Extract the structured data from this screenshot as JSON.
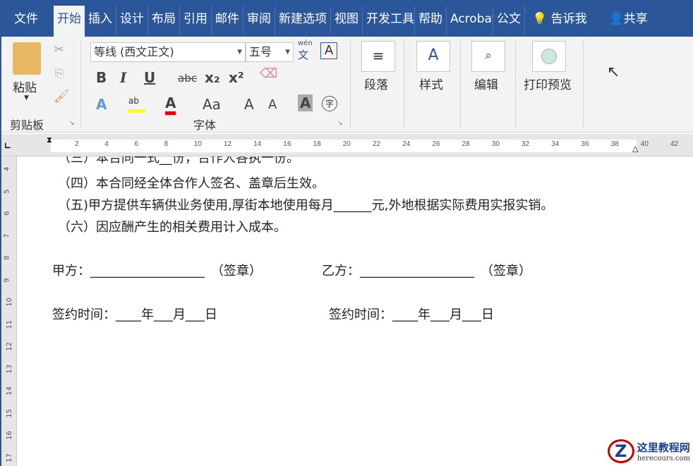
{
  "tabs": [
    "文件",
    "开始",
    "插入",
    "设计",
    "布局",
    "引用",
    "邮件",
    "审阅",
    "新建选项",
    "视图",
    "开发工具",
    "帮助",
    "Acrobat",
    "公文"
  ],
  "tell_me": "告诉我",
  "share": "共享",
  "clipboard": {
    "paste": "粘贴",
    "group": "剪贴板"
  },
  "font": {
    "name": "等线 (西文正文)",
    "size": "五号",
    "group": "字体",
    "phonetic": "wén",
    "phonetic_char": "文",
    "border_char": "A",
    "bold": "B",
    "italic": "I",
    "underline": "U",
    "strike": "abc",
    "sub": "x₂",
    "sup": "x²",
    "case": "Aa",
    "enclose": "字"
  },
  "groups": {
    "paragraph": "段落",
    "styles": "样式",
    "editing": "编辑",
    "print_preview": "打印预览"
  },
  "ruler": [
    "2",
    "4",
    "6",
    "8",
    "10",
    "12",
    "14",
    "16",
    "18",
    "20",
    "22",
    "24",
    "26",
    "28",
    "30",
    "32",
    "34",
    "36",
    "38",
    "40",
    "42"
  ],
  "vruler": [
    "4",
    "5",
    "6",
    "7",
    "8",
    "9",
    "10",
    "11",
    "12",
    "13",
    "14",
    "15",
    "16",
    "17"
  ],
  "doc": {
    "l0": "（三）本合同一式__份，合作人各执一份。",
    "l1": "（四）本合同经全体合作人签名、盖章后生效。",
    "l2": "（五)甲方提供车辆供业务使用,厚街本地使用每月______元,外地根据实际费用实报实销。",
    "l3": "（六）因应酬产生的相关费用计入成本。",
    "sig_a": "甲方：__________________　（签章）",
    "sig_b": "乙方：__________________　（签章）",
    "date_a": "签约时间：____年___月___日",
    "date_b": "签约时间：____年___月___日"
  },
  "watermark": {
    "name": "这里教程网",
    "url": "herecours.com"
  },
  "colors": {
    "accent": "#2b579a",
    "highlight": "#ffff00",
    "font_color": "#e00000"
  }
}
